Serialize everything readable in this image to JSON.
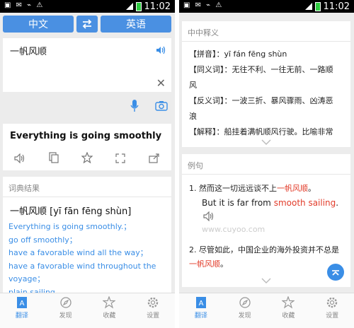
{
  "status_bar": {
    "time": "11:02"
  },
  "left": {
    "lang_from": "中文",
    "lang_to": "英语",
    "input_text": "一帆风顺",
    "result_text": "Everything is going smoothly",
    "dict": {
      "header": "词典结果",
      "headword": "一帆风顺 [yī fān fēng shùn]",
      "defs": [
        "Everything is going smoothly.；",
        "go off smoothly；",
        "have a favorable wind all the way；",
        "have a favorable wind throughout the",
        "voyage；",
        "plain sailing"
      ]
    }
  },
  "right": {
    "meaning": {
      "header": "中中释义",
      "lines": [
        "【拼音】：yī fán fēng shùn",
        "【同义词】：无往不利、一往无前、一路顺",
        "风",
        "【反义词】：一波三折、暴风骤雨、凶涛恶",
        "浪",
        "【解释】：船挂着满帆顺风行驶。比喻非常"
      ]
    },
    "examples": {
      "header": "例句",
      "ex1_num": "1.",
      "ex1_pre": "然而这一切远远谈不上",
      "ex1_hl": "一帆风顺",
      "ex1_post": "。",
      "ex1_en_pre": "But it is far from",
      "ex1_en_hl": "smooth sailing",
      "ex1_en_post": ".",
      "watermark": "www.cuyoo.com",
      "ex2_num": "2.",
      "ex2_pre": "尽管如此，中国企业的海外投资并不总是",
      "ex2_hl": "一帆风顺",
      "ex2_post": "。"
    }
  },
  "tabs": [
    "翻译",
    "发现",
    "收藏",
    "设置"
  ],
  "colors": {
    "accent": "#4a90e2",
    "link": "#3a8ee6",
    "highlight": "#e23c2a"
  }
}
